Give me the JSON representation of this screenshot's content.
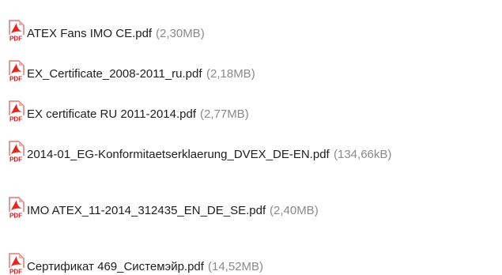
{
  "files": [
    {
      "name": "ATEX Fans IMO CE.pdf",
      "size": "(2,30MB)",
      "icon": "pdf-file-icon",
      "icon_label": "PDF"
    },
    {
      "name": "EX_Certificate_2008-2011_ru.pdf",
      "size": "(2,18MB)",
      "icon": "pdf-file-icon",
      "icon_label": "PDF"
    },
    {
      "name": "EX certificate RU 2011-2014.pdf",
      "size": "(2,77MB)",
      "icon": "pdf-file-icon",
      "icon_label": "PDF"
    },
    {
      "name": "2014-01_EG-Konformitaetserklaerung_DVEX_DE-EN.pdf",
      "size": "(134,66kB)",
      "icon": "pdf-file-icon",
      "icon_label": "PDF"
    },
    {
      "name": "IMO ATEX_11-2014_312435_EN_DE_SE.pdf",
      "size": "(2,40MB)",
      "icon": "pdf-file-icon",
      "icon_label": "PDF"
    },
    {
      "name": "Сертификат 469_Системэйр.pdf",
      "size": "(14,52MB)",
      "icon": "pdf-file-icon",
      "icon_label": "PDF"
    }
  ],
  "colors": {
    "link_text": "#1e1e1e",
    "size_text": "#8a8a8a",
    "pdf_red": "#e0281e",
    "pdf_label_red": "#c8181c"
  }
}
